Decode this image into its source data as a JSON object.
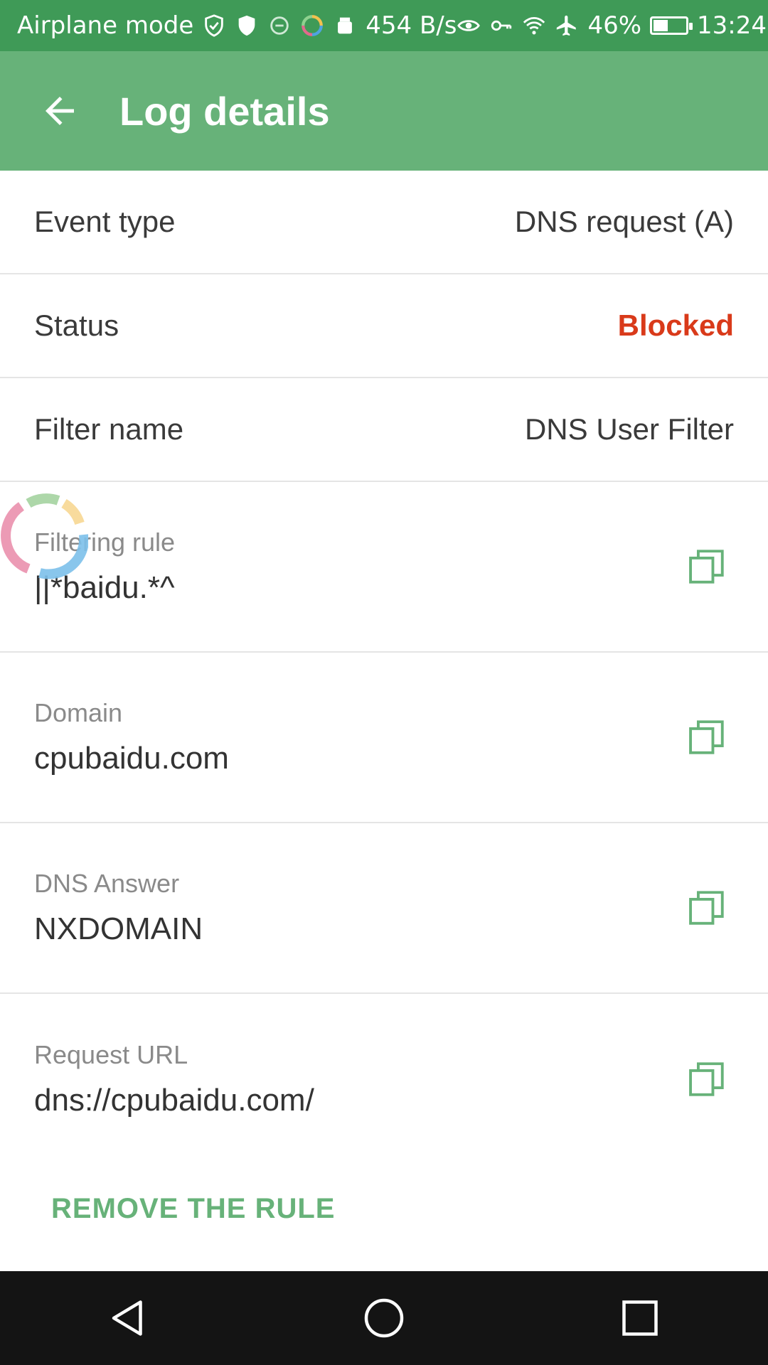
{
  "status_bar": {
    "left_text": "Airplane mode",
    "net_speed": "454 B/s",
    "battery": "46%",
    "battery_level": 0.46,
    "time": "13:24",
    "icons": [
      "shield-outline-icon",
      "shield-icon",
      "vpn-icon",
      "sync-icon",
      "android-icon",
      "eye-icon",
      "key-icon",
      "wifi-icon",
      "airplane-icon",
      "battery-icon"
    ]
  },
  "app_bar": {
    "title": "Log details",
    "back_icon": "arrow-back-icon"
  },
  "rows": [
    {
      "label": "Event type",
      "value": "DNS request (A)"
    },
    {
      "label": "Status",
      "value": "Blocked"
    },
    {
      "label": "Filter name",
      "value": "DNS User Filter"
    }
  ],
  "blocks": [
    {
      "label": "Filtering rule",
      "value": "||*baidu.*^"
    },
    {
      "label": "Domain",
      "value": "cpubaidu.com"
    },
    {
      "label": "DNS Answer",
      "value": "NXDOMAIN"
    },
    {
      "label": "Request URL",
      "value": "dns://cpubaidu.com/"
    }
  ],
  "actions": {
    "remove_rule": "REMOVE THE RULE"
  },
  "colors": {
    "status_bar": "#3f9a57",
    "app_bar": "#67b279",
    "accent": "#67b279",
    "blocked": "#d93a1a",
    "nav_bar": "#141414"
  }
}
